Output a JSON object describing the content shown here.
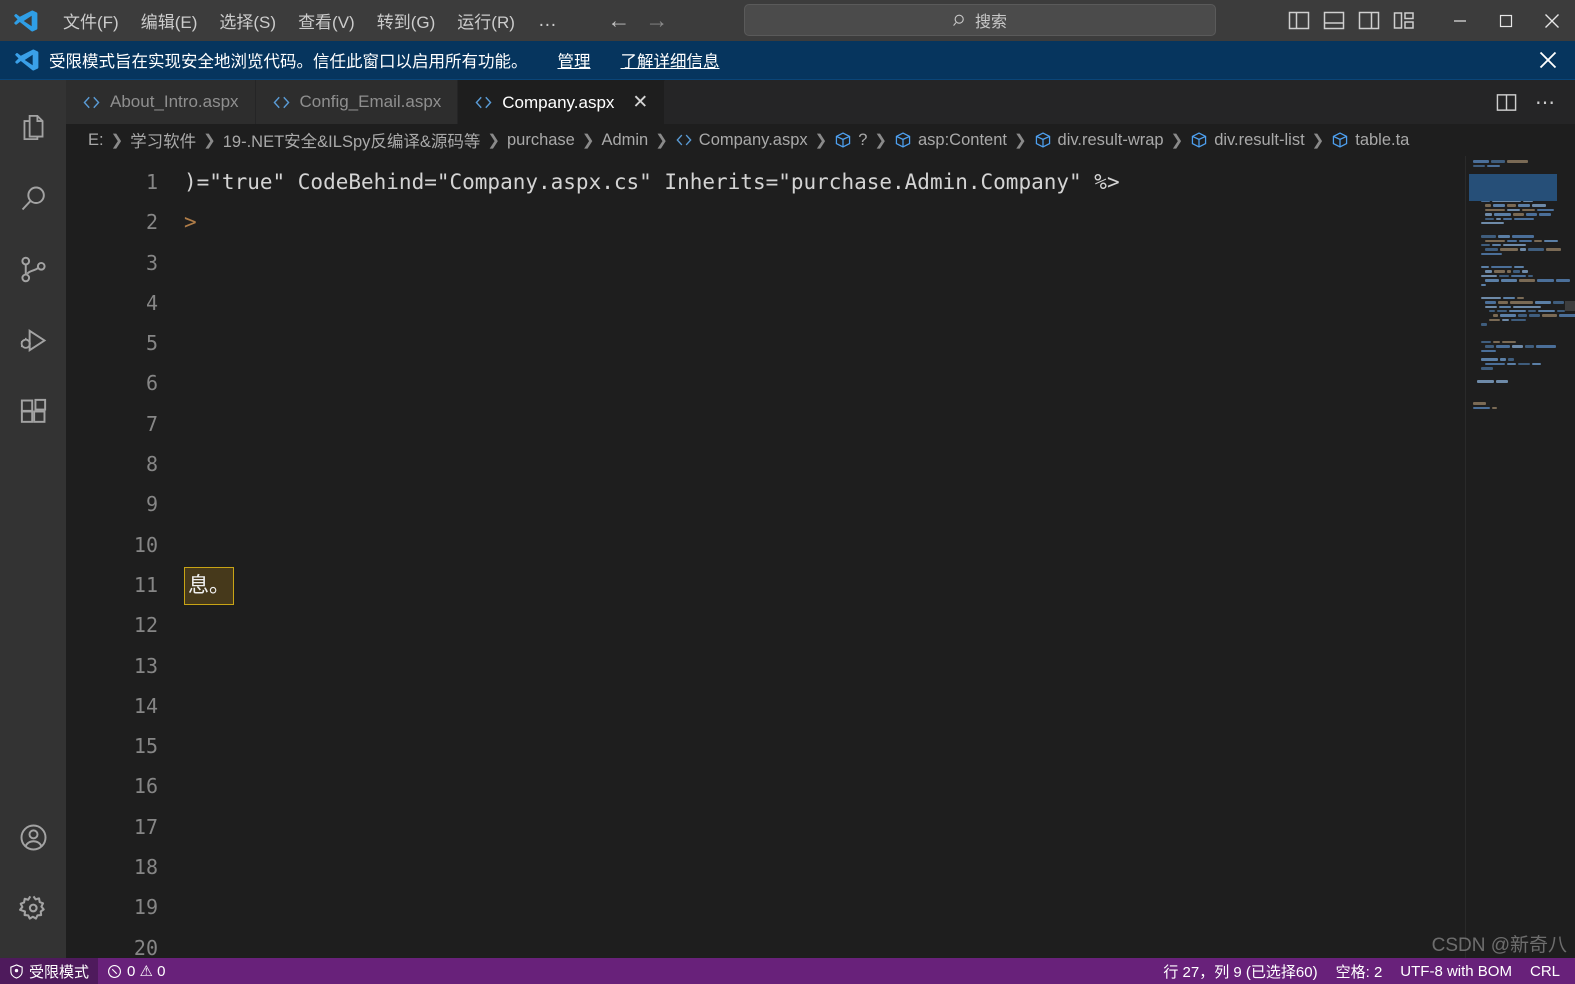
{
  "titlebar": {
    "logo_icon": "vscode-logo",
    "menus": [
      {
        "label": "文件(F)"
      },
      {
        "label": "编辑(E)"
      },
      {
        "label": "选择(S)"
      },
      {
        "label": "查看(V)"
      },
      {
        "label": "转到(G)"
      },
      {
        "label": "运行(R)"
      }
    ],
    "more_label": "…",
    "nav_back_icon": "arrow-left-icon",
    "nav_forward_icon": "arrow-right-icon",
    "search": {
      "placeholder": "搜索",
      "icon": "search-icon"
    },
    "layout_icons": [
      "toggle-primary-sidebar-icon",
      "toggle-panel-icon",
      "toggle-secondary-sidebar-icon",
      "customize-layout-icon"
    ],
    "window_controls": [
      "minimize-icon",
      "maximize-icon",
      "close-icon"
    ]
  },
  "banner": {
    "icon": "vscode-shield-icon",
    "text": "受限模式旨在实现安全地浏览代码。信任此窗口以启用所有功能。",
    "manage_label": "管理",
    "learn_more_label": "了解详细信息",
    "close_icon": "close-icon",
    "background": "#06355e"
  },
  "activitybar": {
    "top": [
      {
        "name": "explorer",
        "icon": "files-icon"
      },
      {
        "name": "search",
        "icon": "search-icon"
      },
      {
        "name": "source-control",
        "icon": "source-control-icon"
      },
      {
        "name": "run-debug",
        "icon": "run-debug-icon"
      },
      {
        "name": "extensions",
        "icon": "extensions-icon"
      }
    ],
    "bottom": [
      {
        "name": "accounts",
        "icon": "account-icon"
      },
      {
        "name": "settings",
        "icon": "gear-icon"
      }
    ]
  },
  "tabs": [
    {
      "label": "About_Intro.aspx",
      "icon": "html-file-icon",
      "active": false
    },
    {
      "label": "Config_Email.aspx",
      "icon": "html-file-icon",
      "active": false
    },
    {
      "label": "Company.aspx",
      "icon": "html-file-icon",
      "active": true,
      "close_icon": "close-icon"
    }
  ],
  "tab_actions": [
    {
      "name": "split-editor",
      "icon": "split-editor-icon"
    },
    {
      "name": "more-actions",
      "icon": "ellipsis-icon",
      "label": "⋯"
    }
  ],
  "breadcrumbs": [
    {
      "label": "E:",
      "icon": null
    },
    {
      "label": "学习软件",
      "icon": null
    },
    {
      "label": "19-.NET安全&ILSpy反编译&源码等",
      "icon": null
    },
    {
      "label": "purchase",
      "icon": null
    },
    {
      "label": "Admin",
      "icon": null
    },
    {
      "label": "Company.aspx",
      "icon": "html-file-icon"
    },
    {
      "label": "?",
      "icon": "symbol-module-icon"
    },
    {
      "label": "asp:Content",
      "icon": "symbol-module-icon"
    },
    {
      "label": "div.result-wrap",
      "icon": "symbol-module-icon"
    },
    {
      "label": "div.result-list",
      "icon": "symbol-module-icon"
    },
    {
      "label": "table.ta",
      "icon": "symbol-module-icon"
    }
  ],
  "editor": {
    "line_numbers": [
      "1",
      "2",
      "3",
      "4",
      "5",
      "6",
      "7",
      "8",
      "9",
      "10",
      "11",
      "12",
      "13",
      "14",
      "15",
      "16",
      "17",
      "18",
      "19",
      "20"
    ],
    "lines": [
      {
        "num": "1",
        "text": ")=\"true\" CodeBehind=\"Company.aspx.cs\" Inherits=\"purchase.Admin.Company\" %>",
        "kind": "code"
      },
      {
        "num": "2",
        "text": ">",
        "kind": "tagend"
      },
      {
        "num": "3",
        "text": "",
        "kind": "empty"
      },
      {
        "num": "4",
        "text": "",
        "kind": "empty"
      },
      {
        "num": "5",
        "text": "",
        "kind": "empty"
      },
      {
        "num": "6",
        "text": "",
        "kind": "empty"
      },
      {
        "num": "7",
        "text": "",
        "kind": "empty"
      },
      {
        "num": "8",
        "text": "",
        "kind": "empty"
      },
      {
        "num": "9",
        "text": "",
        "kind": "empty"
      },
      {
        "num": "10",
        "text": "",
        "kind": "empty"
      },
      {
        "num": "11",
        "text": "息。",
        "kind": "highlight"
      },
      {
        "num": "12",
        "text": "",
        "kind": "empty"
      },
      {
        "num": "13",
        "text": "",
        "kind": "empty"
      },
      {
        "num": "14",
        "text": "",
        "kind": "empty"
      },
      {
        "num": "15",
        "text": "",
        "kind": "empty"
      },
      {
        "num": "16",
        "text": "",
        "kind": "empty"
      },
      {
        "num": "17",
        "text": "",
        "kind": "empty"
      },
      {
        "num": "18",
        "text": "",
        "kind": "empty"
      },
      {
        "num": "19",
        "text": "",
        "kind": "empty"
      },
      {
        "num": "20",
        "text": "",
        "kind": "empty"
      }
    ],
    "highlight_color": "#46391b",
    "highlight_border": "#c8a415",
    "background": "#1e1e1e"
  },
  "statusbar": {
    "background": "#68217a",
    "left": [
      {
        "name": "restricted-mode",
        "icon": "shield-icon",
        "label": "受限模式"
      },
      {
        "name": "problems",
        "icon": "error-warning-icon",
        "label": "0  ⚠ 0"
      }
    ],
    "right": [
      {
        "name": "cursor-position",
        "label": "行 27，列 9 (已选择60)"
      },
      {
        "name": "indentation",
        "label": "空格: 2"
      },
      {
        "name": "encoding",
        "label": "UTF-8 with BOM"
      },
      {
        "name": "eol",
        "label": "CRL"
      }
    ]
  },
  "watermark": {
    "text": "CSDN @新奇八"
  }
}
